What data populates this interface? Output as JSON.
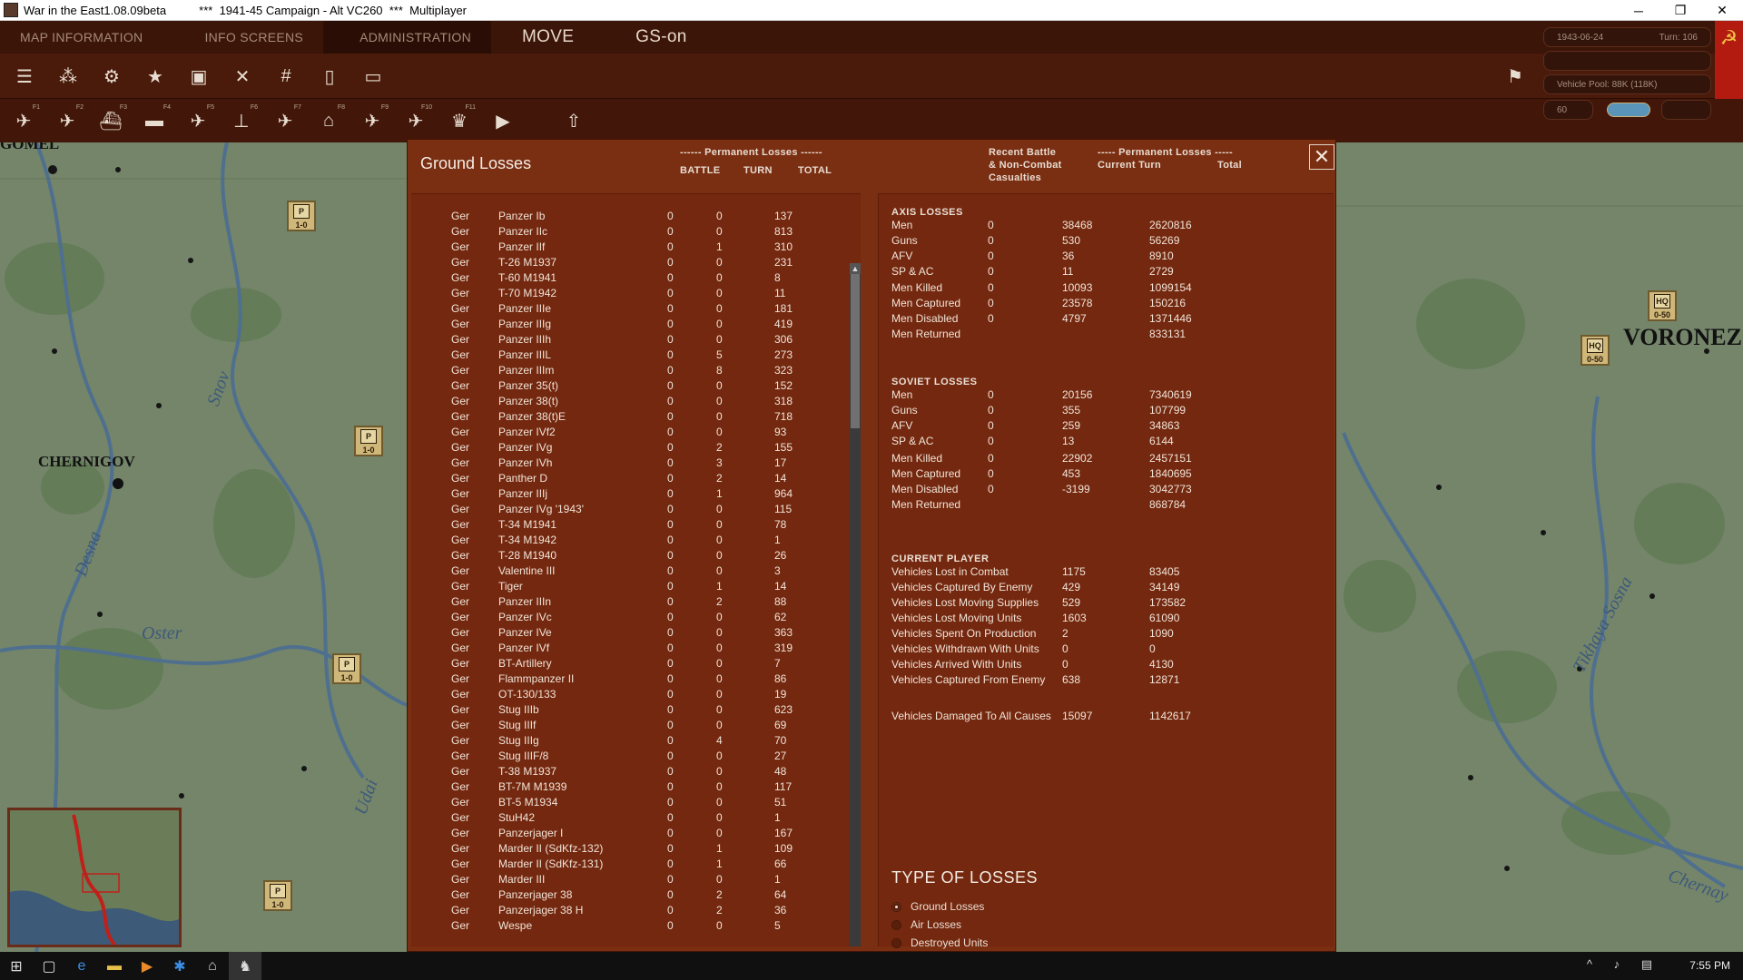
{
  "window": {
    "title": "War in the East1.08.09beta          ***  1941-45 Campaign - Alt VC260  ***  Multiplayer",
    "minimize": "─",
    "maximize": "❐",
    "close": "✕"
  },
  "menu": [
    {
      "label": "MAP INFORMATION"
    },
    {
      "label": "INFO SCREENS"
    },
    {
      "label": "ADMINISTRATION"
    },
    {
      "label": "MOVE"
    },
    {
      "label": "GS-on"
    }
  ],
  "status": {
    "date": "1943-06-24",
    "turn": "Turn: 106",
    "vehicle_pool": "Vehicle Pool: 88K (118K)",
    "value": "60"
  },
  "toolbar_fkeys": [
    "F1",
    "F2",
    "F3",
    "F4",
    "F5",
    "F6",
    "F7",
    "F8",
    "F9",
    "F10",
    "F11"
  ],
  "map": {
    "cities": [
      {
        "name": "GOMEL"
      },
      {
        "name": "CHERNIGOV"
      },
      {
        "name": "VORONEZ"
      }
    ],
    "rivers": [
      {
        "name": "Snov"
      },
      {
        "name": "Desna"
      },
      {
        "name": "Oster"
      },
      {
        "name": "Udai"
      },
      {
        "name": "Tikhaya Sosna"
      },
      {
        "name": "Chernay"
      }
    ],
    "units": [
      {
        "type": "P",
        "strength": "1-0"
      },
      {
        "type": "P",
        "strength": "1-0"
      },
      {
        "type": "P",
        "strength": "1-0"
      },
      {
        "type": "P",
        "strength": "1-0"
      },
      {
        "type": "HQ",
        "strength": "0-50"
      },
      {
        "type": "HQ",
        "strength": "0-50"
      }
    ]
  },
  "panel": {
    "title": "Ground Losses",
    "perm_header": "------ Permanent Losses ------",
    "col_battle": "BATTLE",
    "col_turn": "TURN",
    "col_total": "TOTAL",
    "recent_header_1": "Recent Battle",
    "recent_header_2": "& Non-Combat",
    "recent_header_3": "Casualties",
    "perm_header_2": "----- Permanent Losses -----",
    "col_current_turn": "Current Turn",
    "col_total_2": "Total",
    "close": "✕"
  },
  "losses_list": [
    [
      "Ger",
      "Panzer Ib",
      "0",
      "0",
      "137"
    ],
    [
      "Ger",
      "Panzer IIc",
      "0",
      "0",
      "813"
    ],
    [
      "Ger",
      "Panzer IIf",
      "0",
      "1",
      "310"
    ],
    [
      "Ger",
      "T-26 M1937",
      "0",
      "0",
      "231"
    ],
    [
      "Ger",
      "T-60 M1941",
      "0",
      "0",
      "8"
    ],
    [
      "Ger",
      "T-70 M1942",
      "0",
      "0",
      "11"
    ],
    [
      "Ger",
      "Panzer IIIe",
      "0",
      "0",
      "181"
    ],
    [
      "Ger",
      "Panzer IIIg",
      "0",
      "0",
      "419"
    ],
    [
      "Ger",
      "Panzer IIIh",
      "0",
      "0",
      "306"
    ],
    [
      "Ger",
      "Panzer IIIL",
      "0",
      "5",
      "273"
    ],
    [
      "Ger",
      "Panzer IIIm",
      "0",
      "8",
      "323"
    ],
    [
      "Ger",
      "Panzer 35(t)",
      "0",
      "0",
      "152"
    ],
    [
      "Ger",
      "Panzer 38(t)",
      "0",
      "0",
      "318"
    ],
    [
      "Ger",
      "Panzer 38(t)E",
      "0",
      "0",
      "718"
    ],
    [
      "Ger",
      "Panzer IVf2",
      "0",
      "0",
      "93"
    ],
    [
      "Ger",
      "Panzer IVg",
      "0",
      "2",
      "155"
    ],
    [
      "Ger",
      "Panzer IVh",
      "0",
      "3",
      "17"
    ],
    [
      "Ger",
      "Panther D",
      "0",
      "2",
      "14"
    ],
    [
      "Ger",
      "Panzer IIIj",
      "0",
      "1",
      "964"
    ],
    [
      "Ger",
      "Panzer IVg '1943'",
      "0",
      "0",
      "115"
    ],
    [
      "Ger",
      "T-34 M1941",
      "0",
      "0",
      "78"
    ],
    [
      "Ger",
      "T-34 M1942",
      "0",
      "0",
      "1"
    ],
    [
      "Ger",
      "T-28 M1940",
      "0",
      "0",
      "26"
    ],
    [
      "Ger",
      "Valentine III",
      "0",
      "0",
      "3"
    ],
    [
      "Ger",
      "Tiger",
      "0",
      "1",
      "14"
    ],
    [
      "Ger",
      "Panzer IIIn",
      "0",
      "2",
      "88"
    ],
    [
      "Ger",
      "Panzer IVc",
      "0",
      "0",
      "62"
    ],
    [
      "Ger",
      "Panzer IVe",
      "0",
      "0",
      "363"
    ],
    [
      "Ger",
      "Panzer IVf",
      "0",
      "0",
      "319"
    ],
    [
      "Ger",
      "BT-Artillery",
      "0",
      "0",
      "7"
    ],
    [
      "Ger",
      "Flammpanzer II",
      "0",
      "0",
      "86"
    ],
    [
      "Ger",
      "OT-130/133",
      "0",
      "0",
      "19"
    ],
    [
      "Ger",
      "Stug IIIb",
      "0",
      "0",
      "623"
    ],
    [
      "Ger",
      "Stug IIIf",
      "0",
      "0",
      "69"
    ],
    [
      "Ger",
      "Stug IIIg",
      "0",
      "4",
      "70"
    ],
    [
      "Ger",
      "Stug IIIF/8",
      "0",
      "0",
      "27"
    ],
    [
      "Ger",
      "T-38 M1937",
      "0",
      "0",
      "48"
    ],
    [
      "Ger",
      "BT-7M M1939",
      "0",
      "0",
      "117"
    ],
    [
      "Ger",
      "BT-5 M1934",
      "0",
      "0",
      "51"
    ],
    [
      "Ger",
      "StuH42",
      "0",
      "0",
      "1"
    ],
    [
      "Ger",
      "Panzerjager I",
      "0",
      "0",
      "167"
    ],
    [
      "Ger",
      "Marder II (SdKfz-132)",
      "0",
      "1",
      "109"
    ],
    [
      "Ger",
      "Marder II (SdKfz-131)",
      "0",
      "1",
      "66"
    ],
    [
      "Ger",
      "Marder III",
      "0",
      "0",
      "1"
    ],
    [
      "Ger",
      "Panzerjager 38",
      "0",
      "2",
      "64"
    ],
    [
      "Ger",
      "Panzerjager 38 H",
      "0",
      "2",
      "36"
    ],
    [
      "Ger",
      "Wespe",
      "0",
      "0",
      "5"
    ]
  ],
  "axis": {
    "label": "AXIS LOSSES",
    "rows1": [
      [
        "Men",
        "0",
        "38468",
        "2620816"
      ],
      [
        "Guns",
        "0",
        "530",
        "56269"
      ],
      [
        "AFV",
        "0",
        "36",
        "8910"
      ],
      [
        "SP & AC",
        "0",
        "11",
        "2729"
      ]
    ],
    "rows2": [
      [
        "Men Killed",
        "0",
        "10093",
        "1099154"
      ],
      [
        "Men Captured",
        "0",
        "23578",
        "150216"
      ],
      [
        "Men Disabled",
        "0",
        "4797",
        "1371446"
      ],
      [
        "Men Returned",
        "",
        "",
        "833131"
      ]
    ]
  },
  "soviet": {
    "label": "SOVIET LOSSES",
    "rows1": [
      [
        "Men",
        "0",
        "20156",
        "7340619"
      ],
      [
        "Guns",
        "0",
        "355",
        "107799"
      ],
      [
        "AFV",
        "0",
        "259",
        "34863"
      ],
      [
        "SP & AC",
        "0",
        "13",
        "6144"
      ]
    ],
    "rows2": [
      [
        "Men Killed",
        "0",
        "22902",
        "2457151"
      ],
      [
        "Men Captured",
        "0",
        "453",
        "1840695"
      ],
      [
        "Men Disabled",
        "0",
        "-3199",
        "3042773"
      ],
      [
        "Men Returned",
        "",
        "",
        "868784"
      ]
    ]
  },
  "current_player": {
    "label": "CURRENT PLAYER",
    "rows": [
      [
        "Vehicles Lost in Combat",
        "1175",
        "83405"
      ],
      [
        "Vehicles Captured By Enemy",
        "429",
        "34149"
      ],
      [
        "Vehicles Lost Moving Supplies",
        "529",
        "173582"
      ],
      [
        "Vehicles Lost Moving Units",
        "1603",
        "61090"
      ],
      [
        "Vehicles Spent On Production",
        "2",
        "1090"
      ],
      [
        "Vehicles Withdrawn With Units",
        "0",
        "0"
      ],
      [
        "Vehicles Arrived With Units",
        "0",
        "4130"
      ],
      [
        "Vehicles Captured From Enemy",
        "638",
        "12871"
      ]
    ],
    "damaged": [
      "Vehicles Damaged To All Causes",
      "15097",
      "1142617"
    ]
  },
  "type_of_losses": {
    "label": "TYPE OF LOSSES",
    "options": [
      {
        "label": "Ground Losses",
        "selected": true
      },
      {
        "label": "Air Losses",
        "selected": false
      },
      {
        "label": "Destroyed Units",
        "selected": false
      }
    ]
  },
  "taskbar": {
    "clock": "7:55 PM"
  },
  "colors": {
    "panel": "#7a2e12",
    "menubar": "#3b1508",
    "map": "#74856a"
  }
}
